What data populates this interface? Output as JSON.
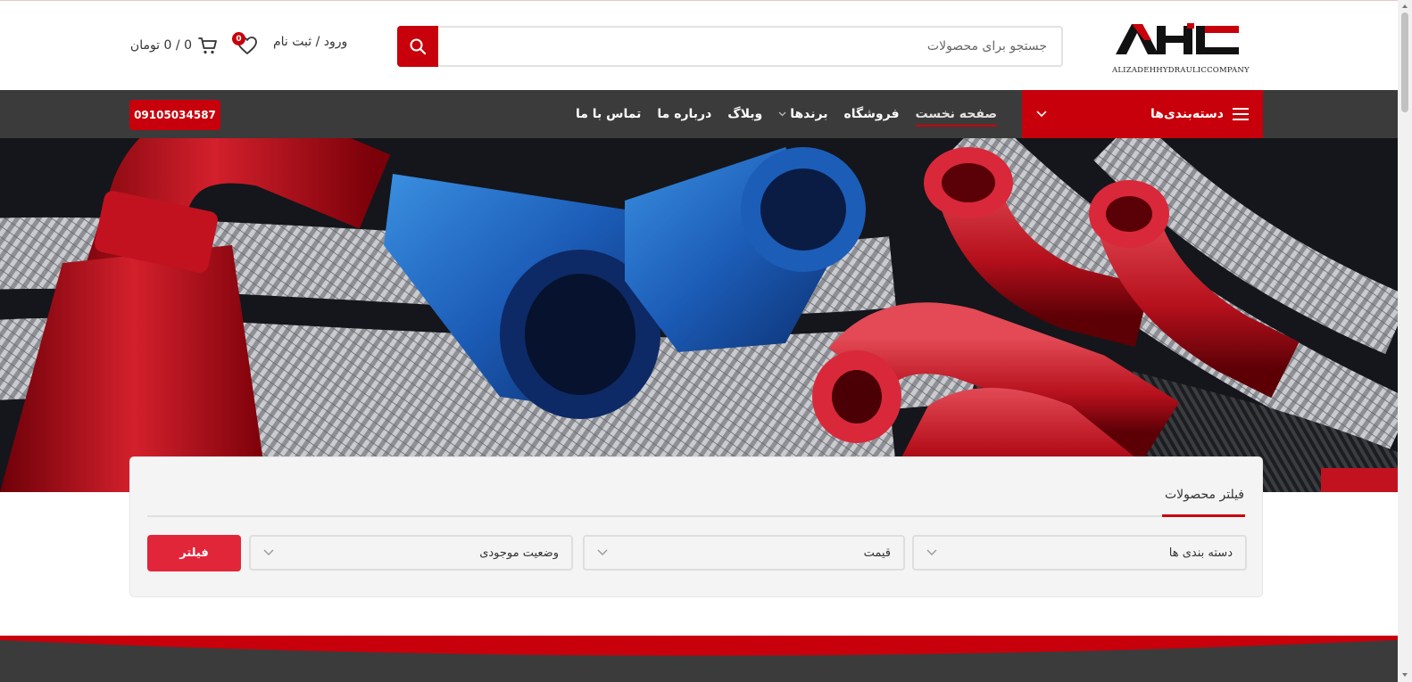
{
  "header": {
    "logo_text": "AHC",
    "logo_caption": [
      "ALIZADEH",
      "HYDRAULIC",
      "COMPANY"
    ],
    "search_placeholder": "جستجو برای محصولات",
    "account_label": "ورود / ثبت نام",
    "wishlist_count": "0",
    "cart_label": "0 / 0 تومان"
  },
  "nav": {
    "categories_label": "دسته‌بندی‌ها",
    "items": [
      {
        "label": "صفحه نخست",
        "active": true
      },
      {
        "label": "فروشگاه"
      },
      {
        "label": "برندها",
        "dropdown": true
      },
      {
        "label": "وبلاگ"
      },
      {
        "label": "درباره ما"
      },
      {
        "label": "تماس با ما"
      }
    ],
    "phone": "09105034587"
  },
  "filter": {
    "title": "فیلتر محصولات",
    "categories": "دسته بندی ها",
    "price": "قیمت",
    "stock": "وضعیت موجودی",
    "button": "فیلتر"
  },
  "colors": {
    "brand_red": "#c8000b",
    "nav_bg": "#3b3b3b",
    "filter_button": "#e2263a"
  },
  "icons": {
    "search": "search-icon",
    "wishlist": "heart-icon",
    "cart": "cart-icon",
    "categories": "hamburger-icon",
    "dropdown": "chevron-down-icon"
  }
}
